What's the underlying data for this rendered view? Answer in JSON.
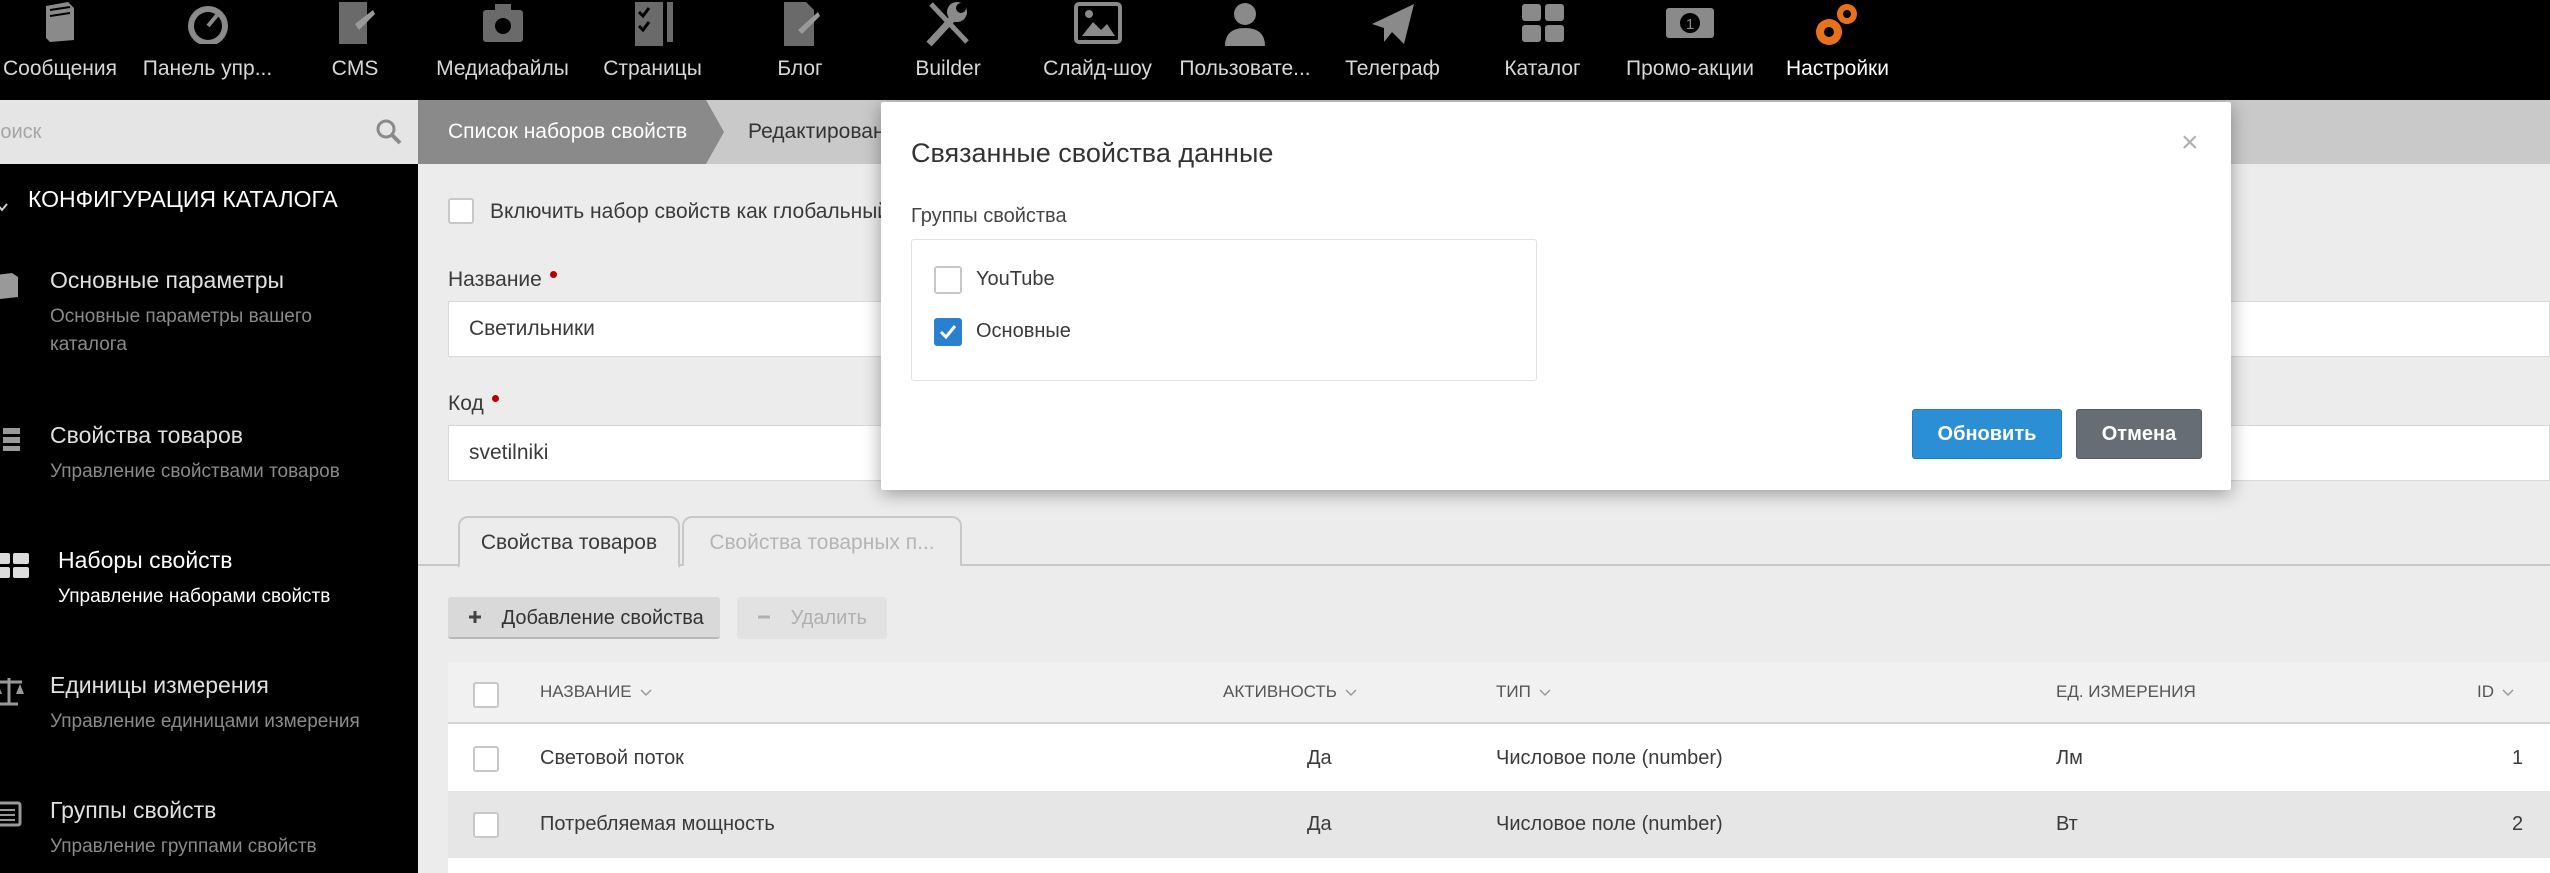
{
  "topnav": {
    "items": [
      {
        "label": "Сообщения",
        "icon": "book-icon"
      },
      {
        "label": "Панель упр...",
        "icon": "speedometer-icon"
      },
      {
        "label": "CMS",
        "icon": "cms-document-icon"
      },
      {
        "label": "Медиафайлы",
        "icon": "media-briefcase-icon"
      },
      {
        "label": "Страницы",
        "icon": "pages-checklist-icon"
      },
      {
        "label": "Блог",
        "icon": "blog-document-icon"
      },
      {
        "label": "Builder",
        "icon": "wrench-icon"
      },
      {
        "label": "Слайд-шоу",
        "icon": "image-icon"
      },
      {
        "label": "Пользовате...",
        "icon": "user-icon"
      },
      {
        "label": "Телеграф",
        "icon": "paper-plane-icon"
      },
      {
        "label": "Каталог",
        "icon": "grid-icon"
      },
      {
        "label": "Промо-акции",
        "icon": "money-icon"
      },
      {
        "label": "Настройки",
        "icon": "gears-icon"
      }
    ],
    "active_index": 12,
    "accent_color": "#e8721c"
  },
  "sidebar": {
    "search_placeholder": "Поиск",
    "section_title": "КОНФИГУРАЦИЯ КАТАЛОГА",
    "items": [
      {
        "title": "Основные параметры",
        "desc": "Основные параметры вашего каталога",
        "icon": "book-icon"
      },
      {
        "title": "Свойства товаров",
        "desc": "Управление свойствами товаров",
        "icon": "list-icon"
      },
      {
        "title": "Наборы свойств",
        "desc": "Управление наборами свойств",
        "icon": "grid-icon"
      },
      {
        "title": "Единицы измерения",
        "desc": "Управление единицами измерения",
        "icon": "scales-icon"
      },
      {
        "title": "Группы свойств",
        "desc": "Управление группами свойств",
        "icon": "list-alt-icon"
      }
    ],
    "active_index": 2
  },
  "breadcrumb": {
    "items": [
      "Список наборов свойств",
      "Редактирован"
    ]
  },
  "form": {
    "global_label": "Включить набор свойств как глобальный",
    "name_label": "Название",
    "name_value": "Светильники",
    "code_label": "Код",
    "code_value": "svetilniki"
  },
  "tabs": {
    "items": [
      "Свойства товаров",
      "Свойства товарных п..."
    ],
    "active_index": 0
  },
  "toolbar": {
    "add_label": "Добавление свойства",
    "delete_label": "Удалить"
  },
  "table": {
    "columns": [
      "НАЗВАНИЕ",
      "АКТИВНОСТЬ",
      "ТИП",
      "ЕД. ИЗМЕРЕНИЯ",
      "ID"
    ],
    "rows": [
      {
        "name": "Световой поток",
        "active": "Да",
        "type": "Числовое поле (number)",
        "unit": "Лм",
        "id": "1"
      },
      {
        "name": "Потребляемая мощность",
        "active": "Да",
        "type": "Числовое поле (number)",
        "unit": "Вт",
        "id": "2"
      }
    ]
  },
  "modal": {
    "title": "Связанные свойства данные",
    "close": "×",
    "group_label": "Группы свойства",
    "options": [
      {
        "label": "YouTube",
        "checked": false
      },
      {
        "label": "Основные",
        "checked": true
      }
    ],
    "update_label": "Обновить",
    "cancel_label": "Отмена",
    "primary_color": "#2b8fd6"
  }
}
